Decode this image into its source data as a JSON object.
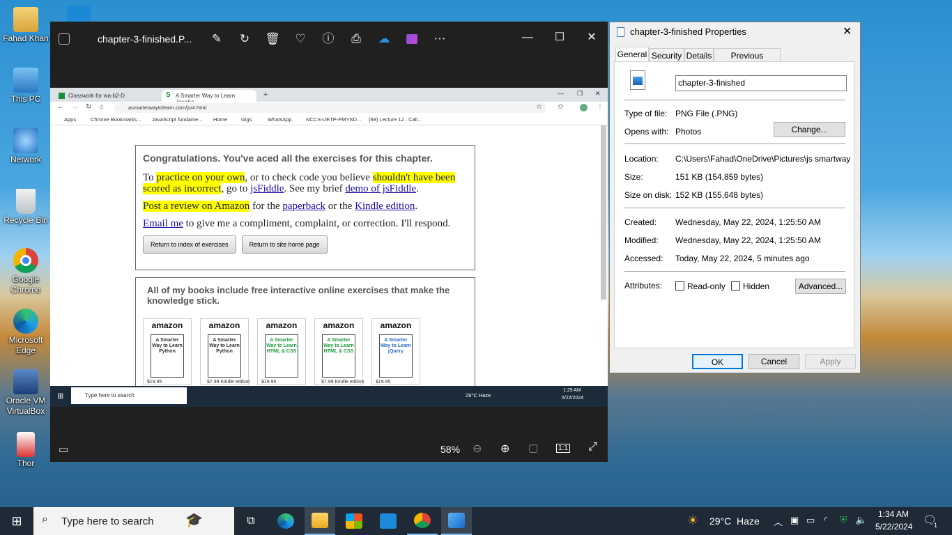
{
  "desktop_icons": [
    {
      "label": "Fahad Khan"
    },
    {
      "label": "This PC"
    },
    {
      "label": "Network"
    },
    {
      "label": "Recycle Bin"
    },
    {
      "label": "Google Chrome"
    },
    {
      "label": "Microsoft Edge"
    },
    {
      "label": "Oracle VM VirtualBox"
    },
    {
      "label": "Thor"
    }
  ],
  "photos": {
    "title": "chapter-3-finished.P...",
    "zoom": "58%",
    "toolbar_icons": [
      "edit-icon",
      "rotate-icon",
      "delete-icon",
      "heart-icon",
      "info-icon",
      "print-icon",
      "onedrive-icon",
      "clipchamp-icon",
      "more-icon"
    ]
  },
  "browser": {
    "tab1": "Classwork for wa-b2-D",
    "tab2": "A Smarter Way to Learn JavaSc...",
    "url": "asmarterwaytolearn.com/js/4.html",
    "bookmarks": [
      "Apps",
      "Chrome Bookmarks...",
      "JavaScript fundame...",
      "Home",
      "Gigs",
      "WhatsApp",
      "NCCS-UETP-PMYSD...",
      "(69) Lecture 12 : Call..."
    ],
    "congrats": "Congratulations. You've aced all the exercises for this chapter.",
    "p1_a": "To ",
    "p1_hl1": "practice on your own",
    "p1_b": ", or to check code you believe ",
    "p1_hl2": "shouldn't have been scored as incorrect",
    "p1_c": ", go to ",
    "p1_link1": "jsFiddle",
    "p1_d": ". See my brief ",
    "p1_link2": "demo of jsFiddle",
    "p1_e": ".",
    "p2_hl": "Post a review on Amazon",
    "p2_a": " for the ",
    "p2_link1": "paperback",
    "p2_b": " or the ",
    "p2_link2": "Kindle edition",
    "p2_c": ".",
    "p3_link": "Email me",
    "p3_a": " to give me a compliment, complaint, or correction. I'll respond.",
    "btn_index": "Return to index of exercises",
    "btn_home": "Return to site home page",
    "books_heading": "All of my books include free interactive online exercises that make the knowledge stick.",
    "books": [
      {
        "brand": "amazon",
        "title": "A Smarter Way to Learn Python",
        "price": "$19.95"
      },
      {
        "brand": "amazon",
        "title": "A Smarter Way to Learn Python",
        "price": "$7.99 Kindle edition"
      },
      {
        "brand": "amazon",
        "title": "A Smarter Way to Learn HTML & CSS",
        "price": "$19.95"
      },
      {
        "brand": "amazon",
        "title": "A Smarter Way to Learn HTML & CSS",
        "price": "$7.99 Kindle edition"
      },
      {
        "brand": "amazon",
        "title": "A Smarter Way to Learn jQuery",
        "price": "$19.95"
      }
    ],
    "inner_taskbar": {
      "search": "Type here to search",
      "weather": "29°C  Haze",
      "time": "1:25 AM",
      "date": "5/22/2024"
    }
  },
  "properties": {
    "title": "chapter-3-finished Properties",
    "tabs": [
      "General",
      "Security",
      "Details",
      "Previous Versions"
    ],
    "filename": "chapter-3-finished",
    "labels": {
      "type": "Type of file:",
      "opens": "Opens with:",
      "location": "Location:",
      "size": "Size:",
      "size_disk": "Size on disk:",
      "created": "Created:",
      "modified": "Modified:",
      "accessed": "Accessed:",
      "attributes": "Attributes:"
    },
    "values": {
      "type": "PNG File (.PNG)",
      "opens": "Photos",
      "location": "C:\\Users\\Fahad\\OneDrive\\Pictures\\js smartway",
      "size": "151 KB (154,859 bytes)",
      "size_disk": "152 KB (155,648 bytes)",
      "created": "Wednesday, May 22, 2024, 1:25:50 AM",
      "modified": "Wednesday, May 22, 2024, 1:25:50 AM",
      "accessed": "Today, May 22, 2024, 5 minutes ago"
    },
    "change_btn": "Change...",
    "readonly": "Read-only",
    "hidden": "Hidden",
    "advanced_btn": "Advanced...",
    "ok": "OK",
    "cancel": "Cancel",
    "apply": "Apply"
  },
  "taskbar": {
    "search": "Type here to search",
    "weather": "29°C  Haze",
    "time": "1:34 AM",
    "date": "5/22/2024",
    "notif_count": "1"
  }
}
